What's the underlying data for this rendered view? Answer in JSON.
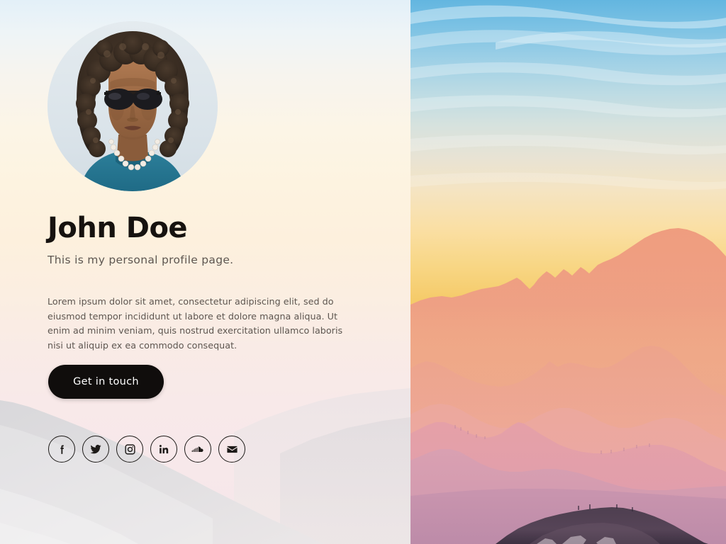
{
  "page": {
    "title": "John Doe",
    "subtitle": "This is my personal profile page.",
    "bio": "Lorem ipsum dolor sit amet, consectetur adipiscing elit, sed do eiusmod tempor incididunt ut labore et dolore magna aliqua. Ut enim ad minim veniam, quis nostrud exercitation ullamco laboris nisi ut aliquip ex ea commodo consequat.",
    "cta_label": "Get in touch"
  },
  "avatar": {
    "name": "profile-photo",
    "description": "Portrait of a person with curly dark hair wearing sunglasses, a pearl necklace and a teal shirt"
  },
  "social": [
    {
      "name": "facebook",
      "label": "Facebook",
      "icon": "facebook-icon"
    },
    {
      "name": "twitter",
      "label": "Twitter",
      "icon": "twitter-icon"
    },
    {
      "name": "instagram",
      "label": "Instagram",
      "icon": "instagram-icon"
    },
    {
      "name": "linkedin",
      "label": "LinkedIn",
      "icon": "linkedin-icon"
    },
    {
      "name": "soundcloud",
      "label": "SoundCloud",
      "icon": "soundcloud-icon"
    },
    {
      "name": "email",
      "label": "Email",
      "icon": "envelope-icon"
    }
  ],
  "theme": {
    "button_bg": "#100d0c",
    "button_text": "#ffffff",
    "heading_color": "#16120f",
    "body_text_color": "#5d5650",
    "icon_border_color": "#1d1a18",
    "left_panel_top": "#e3f0f8",
    "left_panel_bottom": "#f6e6e9",
    "right_sky_top": "#63b6e0",
    "right_sky_gold": "#f5cb6a",
    "right_mountain_salmon": "#ee9f84",
    "right_mountain_pink": "#e6a0a4",
    "right_mountain_mauve": "#c290ae",
    "right_foreground_rock": "#4a3a4a"
  },
  "background": {
    "left_image": "faded-mountain-slope",
    "right_image": "sunset-mountain-range"
  }
}
